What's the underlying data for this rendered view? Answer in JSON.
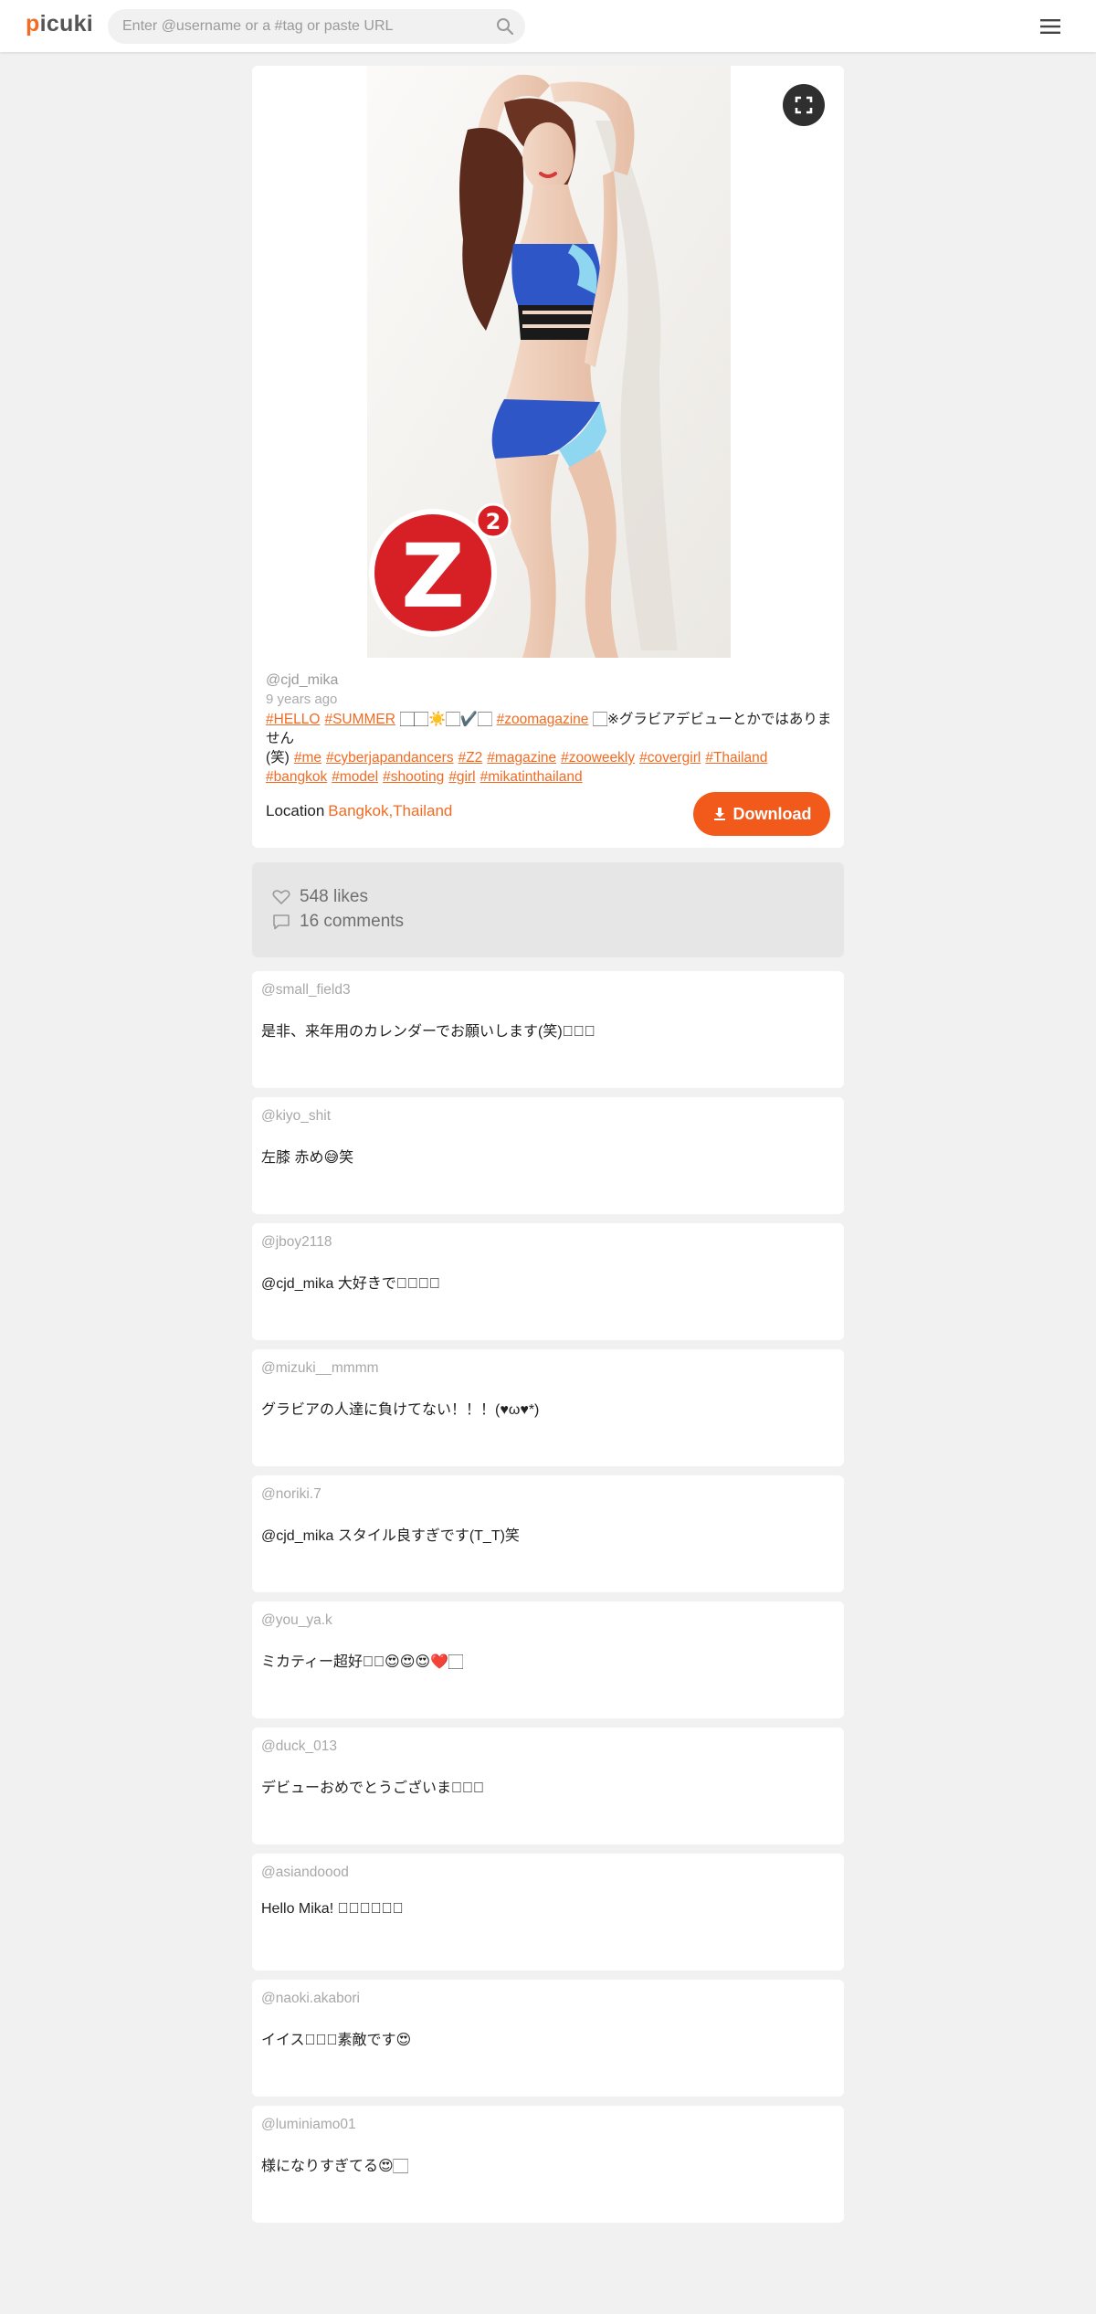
{
  "header": {
    "logo_accent": "p",
    "logo_rest": "icuki",
    "search_placeholder": "Enter @username or a #tag or paste URL"
  },
  "post": {
    "username": "@cjd_mika",
    "time": "9 years ago",
    "caption_lines": [
      {
        "segments": [
          {
            "type": "tag",
            "text": "#HELLO"
          },
          {
            "type": "tag",
            "text": "#SUMMER"
          },
          {
            "type": "text",
            "text": "🏻🏻☀️🏻✔️🏻"
          },
          {
            "type": "tag",
            "text": "#zoomagazine"
          },
          {
            "type": "text",
            "text": "🏻※グラビアデビューとかではありません"
          }
        ]
      },
      {
        "segments": [
          {
            "type": "text",
            "text": "(笑)"
          },
          {
            "type": "tag",
            "text": "#me"
          },
          {
            "type": "tag",
            "text": "#cyberjapandancers"
          },
          {
            "type": "tag",
            "text": "#Z2"
          },
          {
            "type": "tag",
            "text": "#magazine"
          },
          {
            "type": "tag",
            "text": "#zooweekly"
          },
          {
            "type": "tag",
            "text": "#covergirl"
          },
          {
            "type": "tag",
            "text": "#Thailand"
          }
        ]
      },
      {
        "segments": [
          {
            "type": "tag",
            "text": "#bangkok"
          },
          {
            "type": "tag",
            "text": "#model"
          },
          {
            "type": "tag",
            "text": "#shooting"
          },
          {
            "type": "tag",
            "text": "#girl"
          },
          {
            "type": "tag",
            "text": "#mikatinthailand"
          }
        ]
      }
    ],
    "location_label": "Location",
    "location_value": "Bangkok,Thailand",
    "download_label": "Download",
    "image_logo_text": "Z",
    "image_logo_sup": "2"
  },
  "stats": {
    "likes": "548 likes",
    "comments": "16 comments"
  },
  "comments": [
    {
      "user": "@small_field3",
      "text": "是非、来年用のカレンダーでお願いします(笑)🏻🏻🏻"
    },
    {
      "user": "@kiyo_shit",
      "text": "左膝 赤め😅笑"
    },
    {
      "user": "@jboy2118",
      "text": "@cjd_mika 大好きです🏻🏻🏻"
    },
    {
      "user": "@mizuki__mmmm",
      "text": "グラビアの人達に負けてない！！！(♥ω♥*)"
    },
    {
      "user": "@noriki.7",
      "text": "@cjd_mika スタイル良すぎです(T_T)笑"
    },
    {
      "user": "@you_ya.k",
      "text": "ミカティー超好き🏻😍😍😍❤️🏻"
    },
    {
      "user": "@duck_013",
      "text": "デビューおめでとうございます🏻🏻"
    },
    {
      "user": "@asiandoood",
      "text": "Hello Mika! 🏻🏻🏻🏻🏻🏻"
    },
    {
      "user": "@naoki.akabori",
      "text": "イイスッ🏻🏻素敵です😍"
    },
    {
      "user": "@luminiamo01",
      "text": "様になりすぎてる😍🏻"
    }
  ],
  "colors": {
    "accent": "#f26b22",
    "download_bg": "#f25a1c",
    "page_bg": "#f1f1f1"
  },
  "icons": {
    "search": "search-icon",
    "menu": "hamburger-menu-icon",
    "expand": "fullscreen-icon",
    "download": "download-icon",
    "likes": "heart-icon",
    "comments": "comment-bubble-icon"
  }
}
